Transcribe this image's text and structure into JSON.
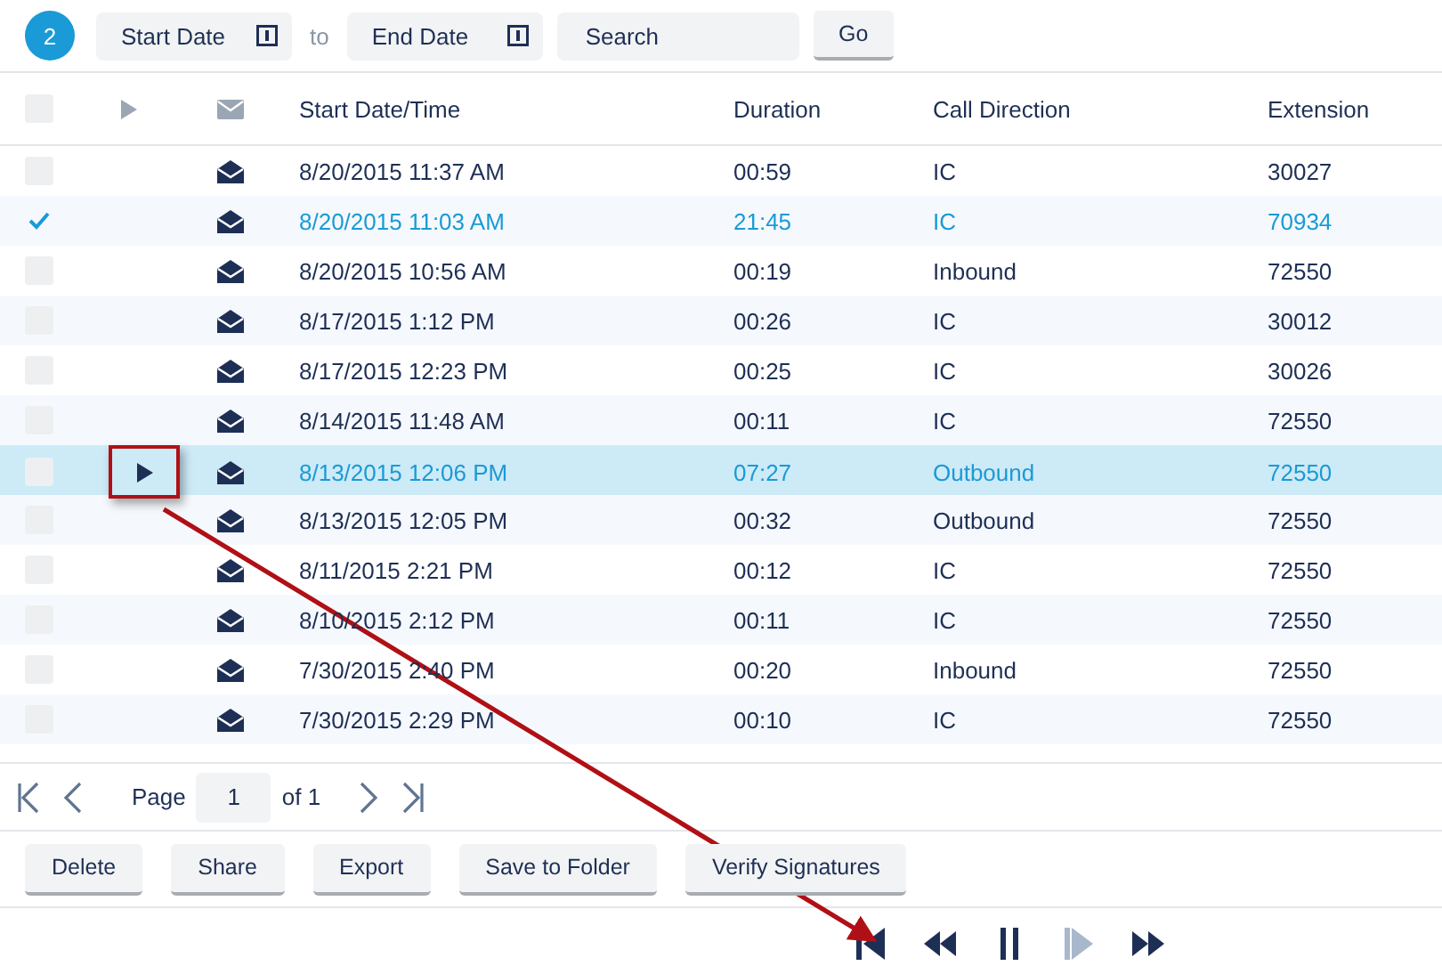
{
  "toolbar": {
    "step": "2",
    "start_date": {
      "placeholder": "Start Date"
    },
    "separator": "to",
    "end_date": {
      "placeholder": "End Date"
    },
    "search": {
      "placeholder": "Search"
    },
    "go": "Go"
  },
  "table": {
    "select_all": {
      "checked": false
    },
    "columns": [
      "Start Date/Time",
      "Duration",
      "Call Direction",
      "Extension"
    ],
    "rows": [
      {
        "checked": false,
        "selected": false,
        "start": "8/20/2015 11:37 AM",
        "duration": "00:59",
        "direction": "IC",
        "extension": "30027"
      },
      {
        "checked": true,
        "selected": false,
        "start": "8/20/2015 11:03 AM",
        "duration": "21:45",
        "direction": "IC",
        "extension": "70934"
      },
      {
        "checked": false,
        "selected": false,
        "start": "8/20/2015 10:56 AM",
        "duration": "00:19",
        "direction": "Inbound",
        "extension": "72550"
      },
      {
        "checked": false,
        "selected": false,
        "start": "8/17/2015 1:12 PM",
        "duration": "00:26",
        "direction": "IC",
        "extension": "30012"
      },
      {
        "checked": false,
        "selected": false,
        "start": "8/17/2015 12:23 PM",
        "duration": "00:25",
        "direction": "IC",
        "extension": "30026"
      },
      {
        "checked": false,
        "selected": false,
        "start": "8/14/2015 11:48 AM",
        "duration": "00:11",
        "direction": "IC",
        "extension": "72550"
      },
      {
        "checked": false,
        "selected": true,
        "start": "8/13/2015 12:06 PM",
        "duration": "07:27",
        "direction": "Outbound",
        "extension": "72550"
      },
      {
        "checked": false,
        "selected": false,
        "start": "8/13/2015 12:05 PM",
        "duration": "00:32",
        "direction": "Outbound",
        "extension": "72550"
      },
      {
        "checked": false,
        "selected": false,
        "start": "8/11/2015 2:21 PM",
        "duration": "00:12",
        "direction": "IC",
        "extension": "72550"
      },
      {
        "checked": false,
        "selected": false,
        "start": "8/10/2015 2:12 PM",
        "duration": "00:11",
        "direction": "IC",
        "extension": "72550"
      },
      {
        "checked": false,
        "selected": false,
        "start": "7/30/2015 2:40 PM",
        "duration": "00:20",
        "direction": "Inbound",
        "extension": "72550"
      },
      {
        "checked": false,
        "selected": false,
        "start": "7/30/2015 2:29 PM",
        "duration": "00:10",
        "direction": "IC",
        "extension": "72550"
      }
    ]
  },
  "pager": {
    "label": "Page",
    "page": "1",
    "of": "of 1"
  },
  "actions": [
    "Delete",
    "Share",
    "Export",
    "Save to Folder",
    "Verify Signatures"
  ],
  "player": [
    {
      "kind": "skip-back",
      "disabled": false
    },
    {
      "kind": "rewind",
      "disabled": false
    },
    {
      "kind": "pause",
      "disabled": false
    },
    {
      "kind": "step",
      "disabled": true
    },
    {
      "kind": "forward",
      "disabled": false
    }
  ]
}
